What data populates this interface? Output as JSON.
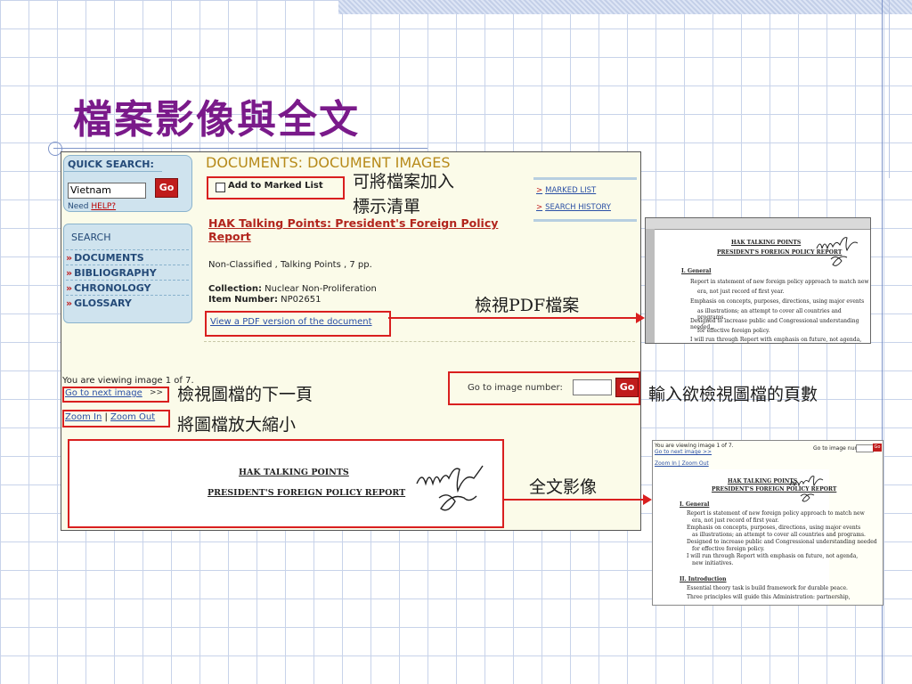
{
  "slide": {
    "title": "檔案影像與全文"
  },
  "shot": {
    "quick_search": {
      "title": "QUICK SEARCH:",
      "input_value": "Vietnam",
      "go_label": "Go",
      "need_text": "Need ",
      "help_link": "HELP?"
    },
    "nav": {
      "title": "SEARCH",
      "items": [
        {
          "label": "DOCUMENTS"
        },
        {
          "label": "BIBLIOGRAPHY"
        },
        {
          "label": "CHRONOLOGY"
        },
        {
          "label": "GLOSSARY"
        }
      ],
      "arrow": "»"
    },
    "doc_header": "DOCUMENTS: DOCUMENT IMAGES",
    "add_marked": "Add to Marked List",
    "right_links": {
      "marked_list": "MARKED LIST",
      "search_history": "SEARCH HISTORY",
      "gt": ">"
    },
    "doc_title": "HAK Talking Points: President's Foreign Policy Report",
    "classification": "Non-Classified , Talking Points , 7 pp.",
    "collection_label": "Collection:",
    "collection_value": " Nuclear Non-Proliferation",
    "item_label": "Item Number:",
    "item_value": " NP02651",
    "pdf_link": "View a PDF version of the document",
    "viewing": "You are viewing image 1 of 7.",
    "next_link": "Go to next image",
    "next_suffix": " >>",
    "zoom_in": "Zoom In",
    "zoom_sep": " | ",
    "zoom_out": "Zoom Out",
    "goto_label": "Go to image number:",
    "goto_go": "Go",
    "image": {
      "line1": "HAK TALKING POINTS",
      "line2": "PRESIDENT'S FOREIGN POLICY REPORT"
    }
  },
  "annotations": {
    "marked_list": "可將檔案加入\n標示清單",
    "pdf": "檢視PDF檔案",
    "next_image": "檢視圖檔的下一頁",
    "zoom": "將圖檔放大縮小",
    "page_number": "輸入欲檢視圖檔的頁數",
    "full_image": "全文影像"
  },
  "thumb1": {
    "line1": "HAK TALKING POINTS",
    "line2": "PRESIDENT'S FOREIGN POLICY REPORT",
    "section": "I.  General",
    "bullets": [
      "Report in statement of new foreign policy approach to match new",
      "era, not just record of first year.",
      "Emphasis on concepts, purposes, directions, using major events",
      "as illustrations; an attempt to cover all countries and programs.",
      "Designed to increase public and Congressional understanding needed",
      "for effective foreign policy.",
      "I will run through Report with emphasis on future, not agenda,"
    ]
  },
  "thumb2": {
    "viewing": "You are viewing image 1 of 7.",
    "next": "Go to next image >>",
    "zoom": "Zoom In | Zoom Out",
    "goto": "Go to image number:",
    "go": "Go",
    "line1": "HAK TALKING POINTS",
    "line2": "PRESIDENT'S FOREIGN POLICY REPORT",
    "section1": "I.  General",
    "bullets1": [
      "Report is statement of new foreign policy approach to match new",
      "era, not just record of first year.",
      "Emphasis on concepts, purposes, directions, using major events",
      "as illustrations; an attempt to cover all countries and programs.",
      "Designed to increase public and Congressional understanding needed",
      "for effective foreign policy.",
      "I will run through Report with emphasis on future, not agenda,",
      "new initiatives."
    ],
    "section2": "II.  Introduction",
    "bullets2": [
      "Essential theory task is build framework for durable peace.",
      "Three principles will guide this Administration: partnership,"
    ]
  }
}
